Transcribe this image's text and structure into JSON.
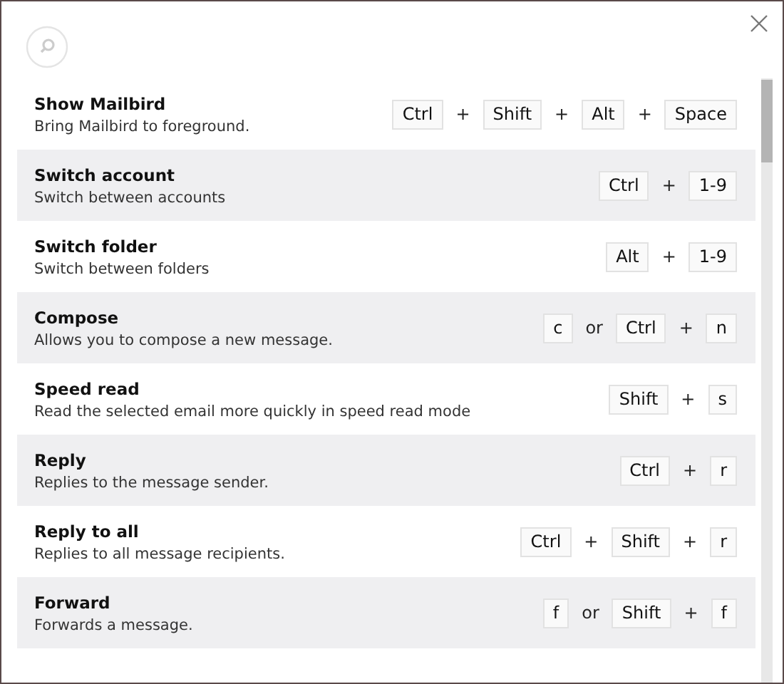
{
  "shortcuts": [
    {
      "title": "Show Mailbird",
      "description": "Bring Mailbird to foreground.",
      "keys": [
        {
          "kind": "key",
          "text": "Ctrl"
        },
        {
          "kind": "sep",
          "text": "+"
        },
        {
          "kind": "key",
          "text": "Shift"
        },
        {
          "kind": "sep",
          "text": "+"
        },
        {
          "kind": "key",
          "text": "Alt"
        },
        {
          "kind": "sep",
          "text": "+"
        },
        {
          "kind": "key",
          "text": "Space"
        }
      ]
    },
    {
      "title": "Switch account",
      "description": "Switch between accounts",
      "keys": [
        {
          "kind": "key",
          "text": "Ctrl"
        },
        {
          "kind": "sep",
          "text": "+"
        },
        {
          "kind": "key",
          "text": "1-9"
        }
      ]
    },
    {
      "title": "Switch folder",
      "description": "Switch between folders",
      "keys": [
        {
          "kind": "key",
          "text": "Alt"
        },
        {
          "kind": "sep",
          "text": "+"
        },
        {
          "kind": "key",
          "text": "1-9"
        }
      ]
    },
    {
      "title": "Compose",
      "description": "Allows you to compose a new message.",
      "keys": [
        {
          "kind": "key",
          "text": "c"
        },
        {
          "kind": "sep",
          "text": "or"
        },
        {
          "kind": "key",
          "text": "Ctrl"
        },
        {
          "kind": "sep",
          "text": "+"
        },
        {
          "kind": "key",
          "text": "n"
        }
      ]
    },
    {
      "title": "Speed read",
      "description": "Read the selected email more quickly in speed read mode",
      "keys": [
        {
          "kind": "key",
          "text": "Shift"
        },
        {
          "kind": "sep",
          "text": "+"
        },
        {
          "kind": "key",
          "text": "s"
        }
      ]
    },
    {
      "title": "Reply",
      "description": "Replies to the message sender.",
      "keys": [
        {
          "kind": "key",
          "text": "Ctrl"
        },
        {
          "kind": "sep",
          "text": "+"
        },
        {
          "kind": "key",
          "text": "r"
        }
      ]
    },
    {
      "title": "Reply to all",
      "description": "Replies to all message recipients.",
      "keys": [
        {
          "kind": "key",
          "text": "Ctrl"
        },
        {
          "kind": "sep",
          "text": "+"
        },
        {
          "kind": "key",
          "text": "Shift"
        },
        {
          "kind": "sep",
          "text": "+"
        },
        {
          "kind": "key",
          "text": "r"
        }
      ]
    },
    {
      "title": "Forward",
      "description": "Forwards a message.",
      "keys": [
        {
          "kind": "key",
          "text": "f"
        },
        {
          "kind": "sep",
          "text": "or"
        },
        {
          "kind": "key",
          "text": "Shift"
        },
        {
          "kind": "sep",
          "text": "+"
        },
        {
          "kind": "key",
          "text": "f"
        }
      ]
    }
  ]
}
